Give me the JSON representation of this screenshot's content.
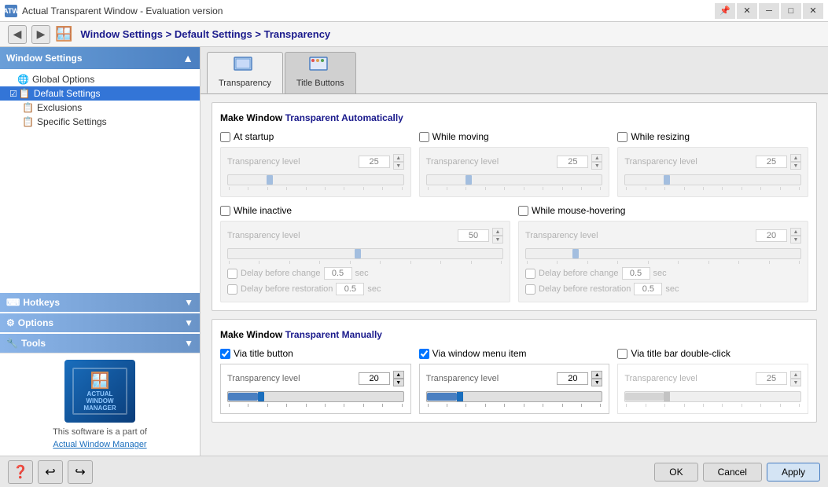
{
  "titleBar": {
    "icon": "ATW",
    "title": "Actual Transparent Window - Evaluation version",
    "buttons": {
      "pin": "📌",
      "close_x": "✕",
      "minimize": "─",
      "maximize": "□",
      "close": "✕"
    }
  },
  "breadcrumb": {
    "back_icon": "◀",
    "forward_icon": "▶",
    "text": "Window Settings > Default Settings > Transparency"
  },
  "sidebar": {
    "header": "Window Settings",
    "items": [
      {
        "id": "global-options",
        "label": "Global Options",
        "indent": 0,
        "selected": false
      },
      {
        "id": "default-settings",
        "label": "Default Settings",
        "indent": 1,
        "selected": true
      },
      {
        "id": "exclusions",
        "label": "Exclusions",
        "indent": 2,
        "selected": false
      },
      {
        "id": "specific-settings",
        "label": "Specific Settings",
        "indent": 2,
        "selected": false
      }
    ],
    "sections": [
      {
        "id": "hotkeys",
        "label": "Hotkeys"
      },
      {
        "id": "options",
        "label": "Options"
      },
      {
        "id": "tools",
        "label": "Tools"
      }
    ],
    "product": {
      "tagline": "This software is a part of",
      "link": "Actual Window Manager"
    }
  },
  "tabs": [
    {
      "id": "transparency",
      "icon": "🪟",
      "label": "Transparency",
      "active": true
    },
    {
      "id": "title-buttons",
      "icon": "🔲",
      "label": "Title Buttons",
      "active": false
    }
  ],
  "auto_section": {
    "title_prefix": "Make Window ",
    "title_bold": "Transparent Automatically",
    "checkboxes": {
      "at_startup": {
        "label": "At startup",
        "checked": false
      },
      "while_moving": {
        "label": "While moving",
        "checked": false
      },
      "while_resizing": {
        "label": "While resizing",
        "checked": false
      },
      "while_inactive": {
        "label": "While inactive",
        "checked": false
      },
      "while_mouse_hovering": {
        "label": "While mouse-hovering",
        "checked": false
      }
    },
    "levels": {
      "at_startup": "25",
      "while_moving": "25",
      "while_resizing": "25",
      "while_inactive": "50",
      "while_mouse_hovering": "20"
    },
    "delays": {
      "inactive_before_change": "0.5",
      "inactive_before_restoration": "0.5",
      "mouse_before_change": "0.5",
      "mouse_before_restoration": "0.5"
    },
    "level_label": "Transparency level",
    "delay_before_change": "Delay before change",
    "delay_before_restoration": "Delay before restoration",
    "sec": "sec"
  },
  "manual_section": {
    "title_prefix": "Make Window ",
    "title_bold": "Transparent Manually",
    "checkboxes": {
      "via_title_button": {
        "label": "Via title button",
        "checked": true
      },
      "via_window_menu": {
        "label": "Via window menu item",
        "checked": true
      },
      "via_title_bar_dbl": {
        "label": "Via title bar double-click",
        "checked": false
      }
    },
    "levels": {
      "via_title_button": "20",
      "via_window_menu": "20",
      "via_title_bar_dbl": "25"
    },
    "level_label": "Transparency level"
  },
  "bottom": {
    "ok_label": "OK",
    "cancel_label": "Cancel",
    "apply_label": "Apply"
  }
}
